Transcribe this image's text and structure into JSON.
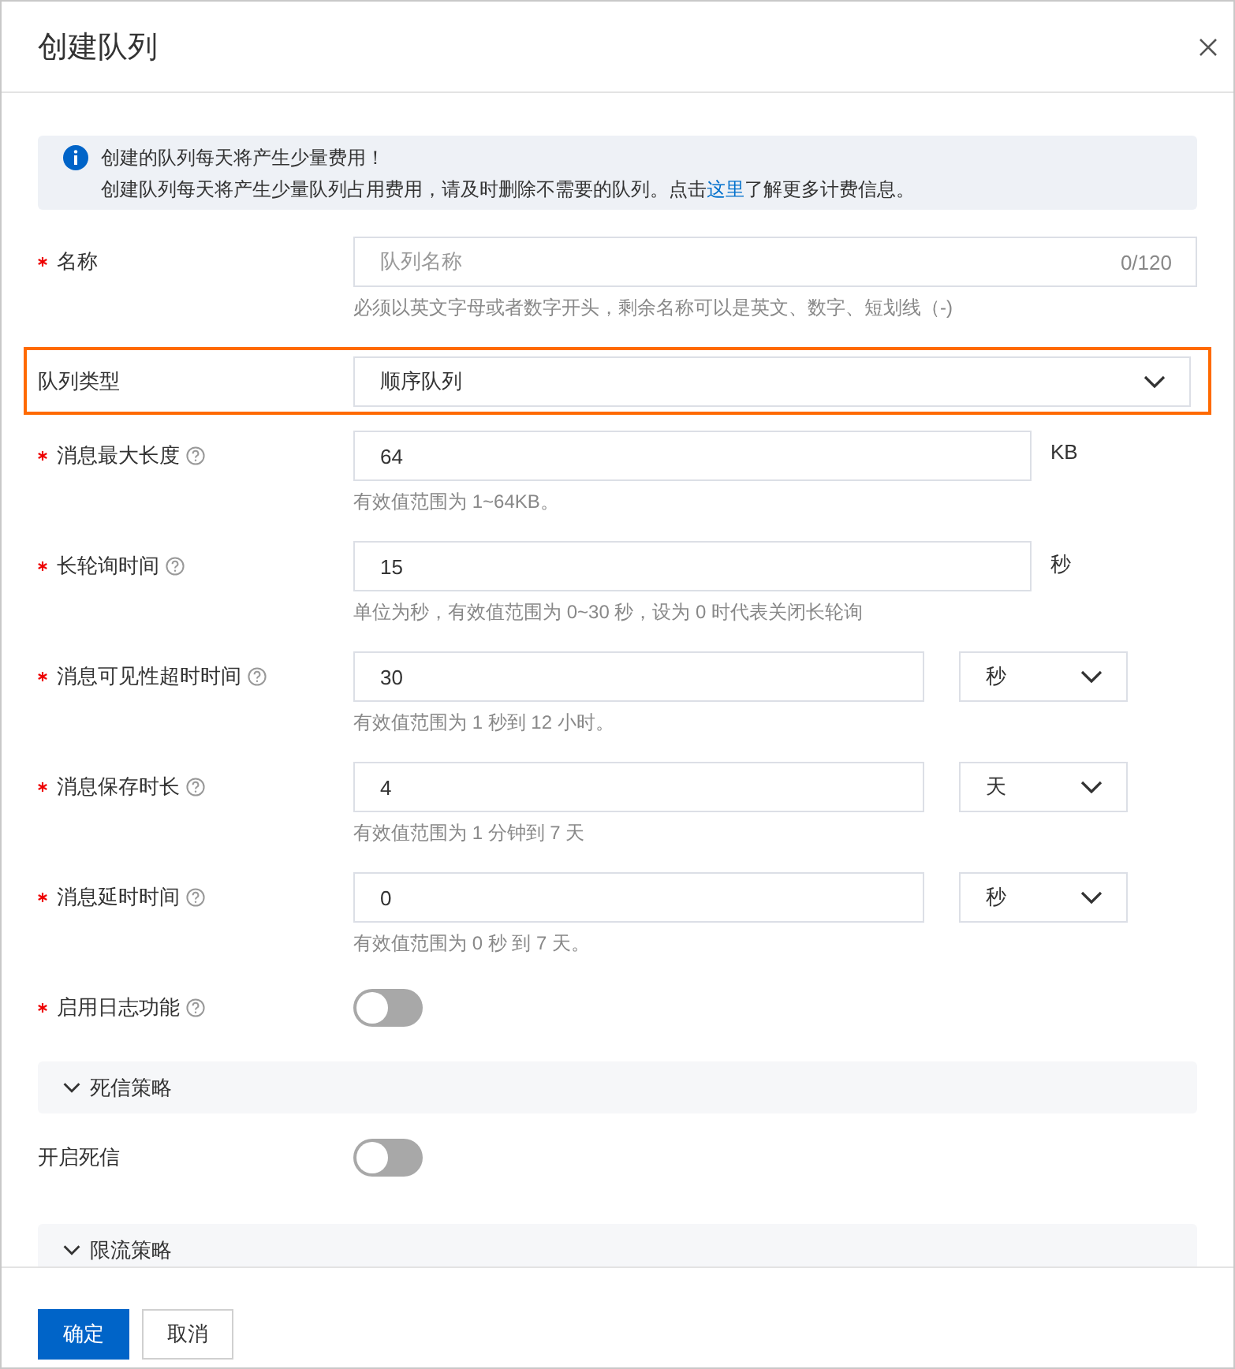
{
  "dialog": {
    "title": "创建队列"
  },
  "notice": {
    "title": "创建的队列每天将产生少量费用！",
    "text_before": "创建队列每天将产生少量队列占用费用，请及时删除不需要的队列。点击",
    "link": "这里",
    "text_after": "了解更多计费信息。"
  },
  "fields": [
    {
      "kind": "text",
      "label": "名称",
      "required": true,
      "help": false,
      "placeholder": "队列名称",
      "counter": "0/120",
      "hint": "必须以英文字母或者数字开头，剩余名称可以是英文、数字、短划线（-)"
    },
    {
      "kind": "select",
      "label": "队列类型",
      "required": false,
      "help": false,
      "value": "顺序队列",
      "highlighted": true
    },
    {
      "kind": "number",
      "label": "消息最大长度",
      "required": true,
      "help": true,
      "value": "64",
      "unit": "KB",
      "hint": "有效值范围为 1~64KB。"
    },
    {
      "kind": "number",
      "label": "长轮询时间",
      "required": true,
      "help": true,
      "value": "15",
      "unit": "秒",
      "hint": "单位为秒，有效值范围为 0~30 秒，设为 0 时代表关闭长轮询"
    },
    {
      "kind": "number_select",
      "label": "消息可见性超时时间",
      "required": true,
      "help": true,
      "value": "30",
      "unit": "秒",
      "hint": "有效值范围为 1 秒到 12 小时。"
    },
    {
      "kind": "number_select",
      "label": "消息保存时长",
      "required": true,
      "help": true,
      "value": "4",
      "unit": "天",
      "hint": "有效值范围为 1 分钟到 7 天"
    },
    {
      "kind": "number_select",
      "label": "消息延时时间",
      "required": true,
      "help": true,
      "value": "0",
      "unit": "秒",
      "hint": "有效值范围为 0 秒 到 7 天。"
    },
    {
      "kind": "toggle",
      "label": "启用日志功能",
      "required": true,
      "help": true,
      "on": false
    }
  ],
  "sections": [
    {
      "title": "死信策略",
      "expanded": true,
      "fields": [
        {
          "kind": "toggle",
          "label": "开启死信",
          "required": false,
          "help": false,
          "on": false
        }
      ]
    },
    {
      "title": "限流策略",
      "expanded": true
    }
  ],
  "buttons": [
    {
      "label": "确定",
      "kind": "primary"
    },
    {
      "label": "取消",
      "kind": "default"
    }
  ]
}
